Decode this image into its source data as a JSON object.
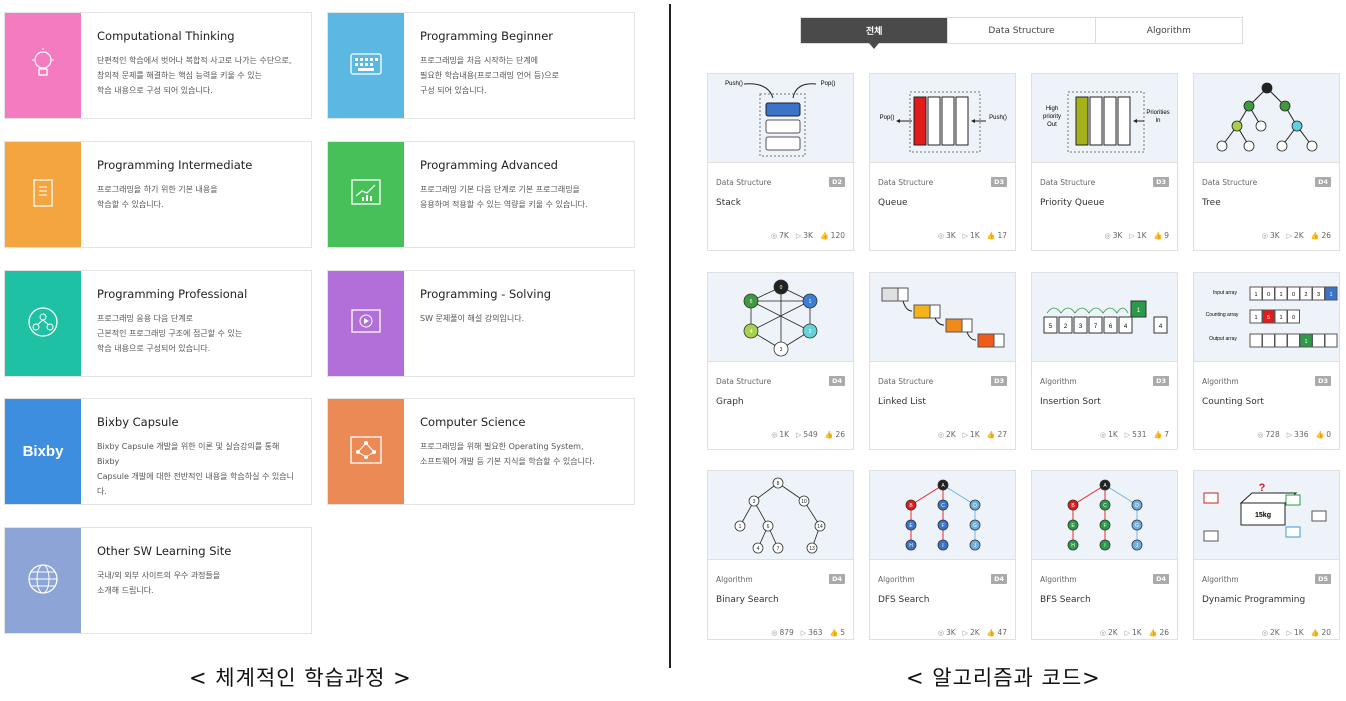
{
  "tracks": [
    {
      "title": "Computational Thinking",
      "lines": [
        "단편적인 학습에서 벗어나 복합적 사고로 나가는 수단으로,",
        "창의적 문제를 해결하는 핵심 능력을 키울 수 있는",
        "학습 내용으로 구성 되어 있습니다."
      ],
      "color": "#f47bbf",
      "icon": "lightbulb-icon"
    },
    {
      "title": "Programming Beginner",
      "lines": [
        "프로그래밍을 처음 시작하는 단계에",
        "필요한 학습내용(프로그래밍 언어 등)으로",
        "구성 되어 있습니다."
      ],
      "color": "#5ab8e3",
      "icon": "keyboard-icon"
    },
    {
      "title": "Programming Intermediate",
      "lines": [
        "프로그래밍을 하기 위한 기본 내용을",
        "학습할 수 있습니다."
      ],
      "color": "#f4a53f",
      "icon": "book-icon"
    },
    {
      "title": "Programming Advanced",
      "lines": [
        "프로그래밍 기본 다음 단계로 기본 프로그래밍을",
        "응용하여 적용할 수 있는 역량을 키울 수 있습니다."
      ],
      "color": "#48c05a",
      "icon": "chart-board-icon"
    },
    {
      "title": "Programming Professional",
      "lines": [
        "프로그래밍 응용 다음 단계로",
        "근본적인 프로그래밍 구조에 접근할 수 있는",
        "학습 내용으로 구성되어 있습니다."
      ],
      "color": "#1fc1a4",
      "icon": "network-globe-icon"
    },
    {
      "title": "Programming - Solving",
      "lines": [
        "SW 문제풀이 해설 강의입니다."
      ],
      "color": "#b36fd9",
      "icon": "video-play-icon"
    },
    {
      "title": "Bixby Capsule",
      "lines": [
        "Bixby Capsule 개발을 위한 이론 및 실습강의를 통해 Bixby",
        "Capsule 개발에 대한 전반적인 내용을 학습하실 수 있습니다."
      ],
      "color": "#3e8ee0",
      "icon": "bixby-logo",
      "logo_text": "Bixby"
    },
    {
      "title": "Computer Science",
      "lines": [
        "프로그래밍을 위해 필요한 Operating System,",
        "소프트웨어 개발 등 기본 지식을 학습할 수 있습니다."
      ],
      "color": "#ec8a55",
      "icon": "circuit-icon"
    },
    {
      "title": "Other SW Learning Site",
      "lines": [
        "국내/외 외부 사이트의 우수 과정들을",
        "소개해 드립니다."
      ],
      "color": "#8ca4d6",
      "icon": "globe-icon"
    }
  ],
  "captions": {
    "left": "< 체계적인 학습과정 >",
    "right": "< 알고리즘과 코드>"
  },
  "tabs": [
    "전체",
    "Data Structure",
    "Algorithm"
  ],
  "active_tab": "전체",
  "algos": [
    {
      "category": "Data Structure",
      "level": "D2",
      "name": "Stack",
      "views": "7K",
      "plays": "3K",
      "likes": "120",
      "diagram": "stack"
    },
    {
      "category": "Data Structure",
      "level": "D3",
      "name": "Queue",
      "views": "3K",
      "plays": "1K",
      "likes": "17",
      "diagram": "queue"
    },
    {
      "category": "Data Structure",
      "level": "D3",
      "name": "Priority Queue",
      "views": "3K",
      "plays": "1K",
      "likes": "9",
      "diagram": "priority-queue"
    },
    {
      "category": "Data Structure",
      "level": "D4",
      "name": "Tree",
      "views": "3K",
      "plays": "2K",
      "likes": "26",
      "diagram": "tree"
    },
    {
      "category": "Data Structure",
      "level": "D4",
      "name": "Graph",
      "views": "1K",
      "plays": "549",
      "likes": "26",
      "diagram": "graph"
    },
    {
      "category": "Data Structure",
      "level": "D3",
      "name": "Linked List",
      "views": "2K",
      "plays": "1K",
      "likes": "27",
      "diagram": "linked-list"
    },
    {
      "category": "Algorithm",
      "level": "D3",
      "name": "Insertion Sort",
      "views": "1K",
      "plays": "531",
      "likes": "7",
      "diagram": "insertion-sort"
    },
    {
      "category": "Algorithm",
      "level": "D3",
      "name": "Counting Sort",
      "views": "728",
      "plays": "336",
      "likes": "0",
      "diagram": "counting-sort"
    },
    {
      "category": "Algorithm",
      "level": "D4",
      "name": "Binary Search",
      "views": "879",
      "plays": "363",
      "likes": "5",
      "diagram": "binary-search"
    },
    {
      "category": "Algorithm",
      "level": "D4",
      "name": "DFS Search",
      "views": "3K",
      "plays": "2K",
      "likes": "47",
      "diagram": "dfs"
    },
    {
      "category": "Algorithm",
      "level": "D4",
      "name": "BFS Search",
      "views": "2K",
      "plays": "1K",
      "likes": "26",
      "diagram": "bfs"
    },
    {
      "category": "Algorithm",
      "level": "D5",
      "name": "Dynamic Programming",
      "views": "2K",
      "plays": "1K",
      "likes": "20",
      "diagram": "dynamic-programming"
    }
  ],
  "diagram_text": {
    "stack": {
      "push": "Push()",
      "pop": "Pop()"
    },
    "queue": {
      "pop": "Pop()",
      "push": "Push()"
    },
    "priority": {
      "high": [
        "High",
        "priority",
        "Out"
      ],
      "prio": [
        "Priorities",
        "In"
      ]
    },
    "graph": {
      "nodes": [
        "0",
        "1",
        "2",
        "3",
        "4",
        "5"
      ]
    },
    "insertion": {
      "values": [
        "5",
        "2",
        "3",
        "7",
        "6",
        "4"
      ],
      "key": "1"
    },
    "counting": {
      "input_label": "Input array",
      "counting_label": "Counting array",
      "output_label": "Output array",
      "input": [
        "1",
        "0",
        "1",
        "0",
        "2",
        "3",
        "1"
      ],
      "counting": [
        "1",
        "5",
        "1",
        "0"
      ],
      "output_value": "1"
    },
    "binary": {
      "nodes": [
        "8",
        "3",
        "10",
        "1",
        "6",
        "14",
        "4",
        "7",
        "13"
      ]
    },
    "tree_nodes": [
      "A",
      "B",
      "C",
      "D",
      "E",
      "F",
      "G",
      "H",
      "I",
      "J"
    ],
    "dp": {
      "question": "?",
      "weight": "15kg"
    }
  }
}
